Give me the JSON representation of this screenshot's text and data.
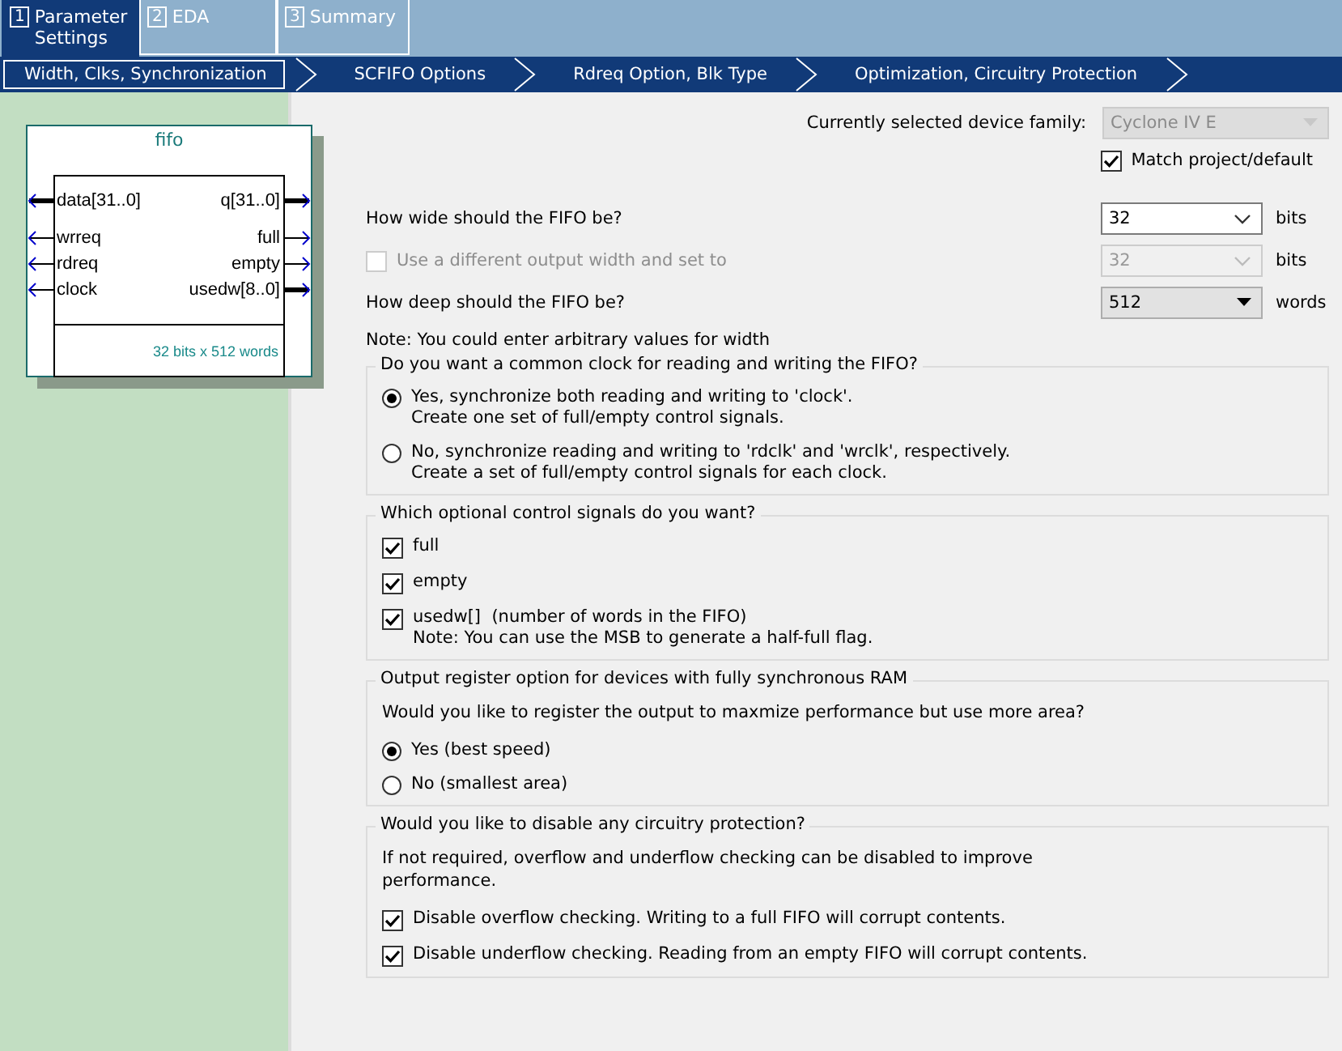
{
  "tabs": [
    {
      "number": "1",
      "label": "Parameter Settings",
      "selected": true
    },
    {
      "number": "2",
      "label": "EDA",
      "selected": false
    },
    {
      "number": "3",
      "label": "Summary",
      "selected": false
    }
  ],
  "steps": [
    {
      "label": "Width, Clks, Synchronization",
      "selected": true
    },
    {
      "label": "SCFIFO Options",
      "selected": false
    },
    {
      "label": "Rdreq Option, Blk Type",
      "selected": false
    },
    {
      "label": "Optimization, Circuitry Protection",
      "selected": false
    }
  ],
  "symbol": {
    "title": "fifo",
    "inputs": [
      {
        "name": "data[31..0]",
        "bus": true
      },
      {
        "name": "wrreq",
        "bus": false
      },
      {
        "name": "rdreq",
        "bus": false
      },
      {
        "name": "clock",
        "bus": false
      }
    ],
    "outputs": [
      {
        "name": "q[31..0]",
        "bus": true
      },
      {
        "name": "full",
        "bus": false
      },
      {
        "name": "empty",
        "bus": false
      },
      {
        "name": "usedw[8..0]",
        "bus": true
      }
    ],
    "footer": "32 bits x 512 words"
  },
  "device": {
    "label": "Currently selected device family:",
    "value": "Cyclone IV E",
    "disabled": true
  },
  "match_project": {
    "label": "Match project/default",
    "checked": true
  },
  "width": {
    "label": "How wide should the FIFO be?",
    "value": "32",
    "unit": "bits"
  },
  "output_width": {
    "label": "Use a different output width and set to",
    "checked": false,
    "disabled": true,
    "value": "32",
    "unit": "bits"
  },
  "depth": {
    "label": "How deep should the FIFO be?",
    "value": "512",
    "unit": "words"
  },
  "note": "Note: You could enter arbitrary values for width",
  "groups": [
    {
      "title": "Do you want a common clock for reading and writing the FIFO?",
      "items": [
        {
          "kind": "radio",
          "lines": [
            "Yes, synchronize both reading and writing to 'clock'.",
            "Create one set of full/empty control signals."
          ],
          "selected": true
        },
        {
          "kind": "radio",
          "lines": [
            "No, synchronize reading and writing to 'rdclk' and 'wrclk', respectively.",
            "Create a set of full/empty control signals for each clock."
          ],
          "selected": false
        }
      ]
    },
    {
      "title": "Which optional control signals do you want?",
      "items": [
        {
          "kind": "checkbox",
          "lines": [
            "full"
          ],
          "checked": true
        },
        {
          "kind": "checkbox",
          "lines": [
            "empty"
          ],
          "checked": true
        },
        {
          "kind": "checkbox",
          "lines": [
            "usedw[]  (number of words in the FIFO)",
            "Note: You can use the MSB to generate a half-full flag."
          ],
          "checked": true
        }
      ]
    },
    {
      "title": "Output register option for devices with fully synchronous RAM",
      "items": [
        {
          "kind": "text",
          "lines": [
            "Would you like to register the output to maxmize performance but use more area?"
          ]
        },
        {
          "kind": "radio",
          "lines": [
            "Yes (best speed)"
          ],
          "selected": true
        },
        {
          "kind": "radio",
          "lines": [
            "No (smallest area)"
          ],
          "selected": false
        }
      ]
    },
    {
      "title": "Would you like to disable any circuitry protection?",
      "items": [
        {
          "kind": "text",
          "lines": [
            "If not required, overflow and underflow checking can be disabled to improve",
            "performance."
          ]
        },
        {
          "kind": "checkbox",
          "lines": [
            "Disable overflow checking. Writing to a full FIFO will corrupt contents."
          ],
          "checked": true
        },
        {
          "kind": "checkbox",
          "lines": [
            "Disable underflow checking. Reading from an empty FIFO will corrupt contents."
          ],
          "checked": true
        }
      ]
    }
  ]
}
